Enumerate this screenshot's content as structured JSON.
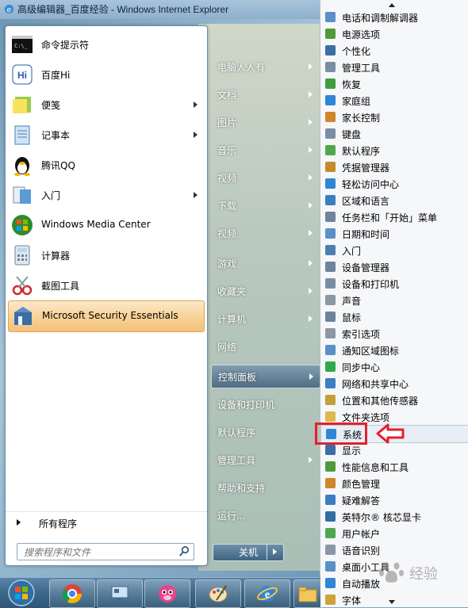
{
  "window": {
    "title": "高级编辑器_百度经验 - Windows Internet Explorer"
  },
  "start_menu": {
    "pinned": [
      {
        "label": "命令提示符",
        "icon": "cmd-icon",
        "submenu": false
      },
      {
        "label": "百度Hi",
        "icon": "baidu-hi-icon",
        "submenu": false
      },
      {
        "label": "便笺",
        "icon": "sticky-notes-icon",
        "submenu": true
      },
      {
        "label": "记事本",
        "icon": "notepad-icon",
        "submenu": true
      },
      {
        "label": "腾讯QQ",
        "icon": "qq-penguin-icon",
        "submenu": false
      },
      {
        "label": "入门",
        "icon": "getting-started-icon",
        "submenu": true
      },
      {
        "label": "Windows Media Center",
        "icon": "media-center-icon",
        "submenu": false
      },
      {
        "label": "计算器",
        "icon": "calculator-icon",
        "submenu": false
      },
      {
        "label": "截图工具",
        "icon": "snipping-tool-icon",
        "submenu": false
      },
      {
        "label": "Microsoft Security Essentials",
        "icon": "security-essentials-icon",
        "submenu": false
      }
    ],
    "all_programs": "所有程序",
    "search_placeholder": "搜索程序和文件",
    "places": [
      {
        "label": "电脑人人有",
        "submenu": true
      },
      {
        "label": "文档",
        "submenu": true
      },
      {
        "label": "图片",
        "submenu": true
      },
      {
        "label": "音乐",
        "submenu": true
      },
      {
        "label": "视频",
        "submenu": true
      },
      {
        "label": "下载",
        "submenu": true
      },
      {
        "label": "视频",
        "submenu": true
      },
      {
        "label": "游戏",
        "submenu": true
      },
      {
        "label": "收藏夹",
        "submenu": true
      },
      {
        "label": "计算机",
        "submenu": true
      },
      {
        "label": "网络",
        "submenu": false
      },
      {
        "label": "控制面板",
        "submenu": true,
        "active": true
      },
      {
        "label": "设备和打印机",
        "submenu": false
      },
      {
        "label": "默认程序",
        "submenu": false
      },
      {
        "label": "管理工具",
        "submenu": true
      },
      {
        "label": "帮助和支持",
        "submenu": false
      },
      {
        "label": "运行...",
        "submenu": false
      }
    ],
    "shutdown_label": "关机"
  },
  "control_panel": {
    "items": [
      "电话和调制解调器",
      "电源选项",
      "个性化",
      "管理工具",
      "恢复",
      "家庭组",
      "家长控制",
      "键盘",
      "默认程序",
      "凭据管理器",
      "轻松访问中心",
      "区域和语言",
      "任务栏和「开始」菜单",
      "日期和时间",
      "入门",
      "设备管理器",
      "设备和打印机",
      "声音",
      "鼠标",
      "索引选项",
      "通知区域图标",
      "同步中心",
      "网络和共享中心",
      "位置和其他传感器",
      "文件夹选项",
      "系统",
      "显示",
      "性能信息和工具",
      "颜色管理",
      "疑难解答",
      "英特尔® 核芯显卡",
      "用户帐户",
      "语音识别",
      "桌面小工具",
      "自动播放",
      "字体"
    ],
    "highlighted": "系统"
  },
  "taskbar": {
    "buttons": [
      "chrome-icon",
      "remote-desktop-icon",
      "cow-app-icon",
      "paint-icon",
      "ie-icon",
      "explorer-folder-icon"
    ]
  },
  "watermark": {
    "text": "经验"
  },
  "colors": {
    "highlight_border": "#e2a552",
    "annotation_red": "#e3212b"
  }
}
